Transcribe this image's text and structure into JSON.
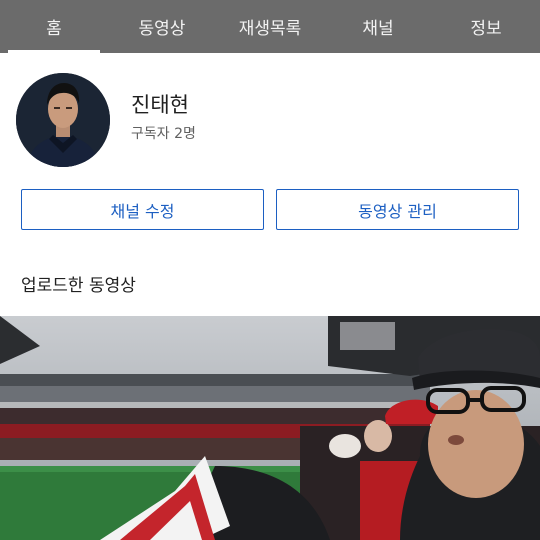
{
  "tabs": [
    {
      "label": "홈",
      "active": true
    },
    {
      "label": "동영상",
      "active": false
    },
    {
      "label": "재생목록",
      "active": false
    },
    {
      "label": "채널",
      "active": false
    },
    {
      "label": "정보",
      "active": false
    }
  ],
  "channel": {
    "name": "진태현",
    "subscribers": "구독자 2명"
  },
  "buttons": {
    "edit_channel": "채널 수정",
    "manage_videos": "동영상 관리"
  },
  "uploads": {
    "section_title": "업로드한 동영상"
  },
  "colors": {
    "tab_bar": "#6b6b6b",
    "accent": "#1c5fc2"
  }
}
